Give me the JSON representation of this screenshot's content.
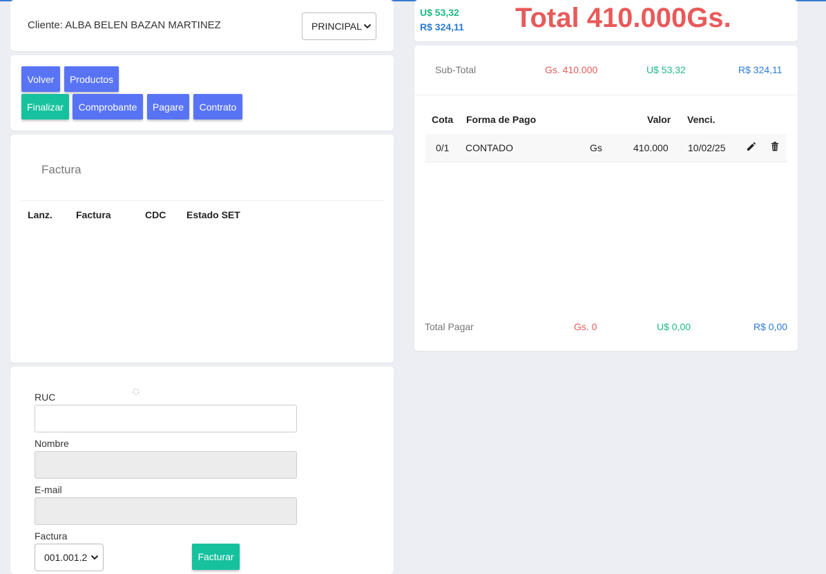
{
  "client": {
    "label": "Cliente: ALBA BELEN BAZAN MARTINEZ",
    "branch_select": "PRINCIPAL"
  },
  "actions": {
    "volver": "Volver",
    "productos": "Productos",
    "finalizar": "Finalizar",
    "comprobante": "Comprobante",
    "pagare": "Pagare",
    "contrato": "Contrato"
  },
  "factura_list": {
    "title": "Factura",
    "columns": [
      "Lanz.",
      "Factura",
      "CDC",
      "Estado SET"
    ]
  },
  "billing_form": {
    "ruc_label": "RUC",
    "ruc_value": "",
    "nombre_label": "Nombre",
    "email_label": "E-mail",
    "factura_label": "Factura",
    "factura_select": "001.001.2",
    "submit": "Facturar"
  },
  "totals": {
    "usd": "U$ 53,32",
    "brl": "R$ 324,11",
    "grand_total": "Total 410.000Gs."
  },
  "subtotal": {
    "label": "Sub-Total",
    "gs": "Gs. 410.000",
    "usd": "U$ 53,32",
    "brl": "R$ 324,11"
  },
  "payments": {
    "columns": {
      "cota": "Cota",
      "forma": "Forma de Pago",
      "valor": "Valor",
      "venci": "Venci."
    },
    "rows": [
      {
        "cota": "0/1",
        "forma": "CONTADO",
        "currency": "Gs",
        "valor": "410.000",
        "venci": "10/02/25"
      }
    ]
  },
  "total_pagar": {
    "label": "Total Pagar",
    "gs": "Gs. 0",
    "usd": "U$ 0,00",
    "brl": "R$ 0,00"
  },
  "icons": {
    "edit": "pencil-icon",
    "delete": "trash-icon",
    "dropdown": "chevron-down-icon",
    "loading": "spinner-icon"
  },
  "colors": {
    "primary_button": "#5874f5",
    "success_button": "#16c19e",
    "total_red": "#e85a5a",
    "usd_green": "#1db980",
    "brl_blue": "#2a7bd4"
  }
}
